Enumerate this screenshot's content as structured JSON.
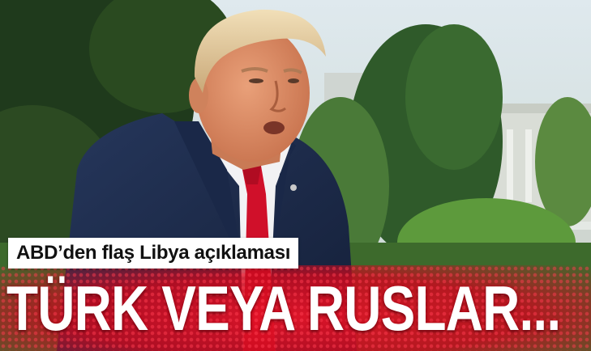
{
  "kicker": "ABD’den flaş Libya açıklaması",
  "headline": "TÜRK VEYA RUSLAR...",
  "colors": {
    "headline_red": "#e21a30",
    "kicker_bg": "#ffffff",
    "suit_navy": "#1c2a4a",
    "tie_red": "#d0102a"
  }
}
